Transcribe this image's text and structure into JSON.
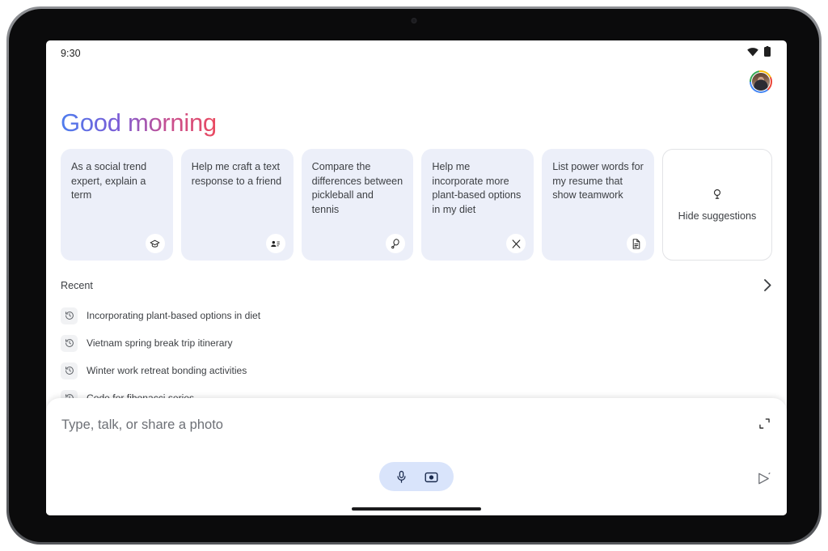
{
  "status_bar": {
    "time": "9:30",
    "icons": [
      "wifi-icon",
      "battery-icon"
    ]
  },
  "account": {
    "avatar_name": "avatar"
  },
  "greeting": {
    "text": "Good morning",
    "gradient_from": "#4285f4",
    "gradient_to": "#ea4a5f"
  },
  "suggestions": {
    "cards": [
      {
        "text": "As a social trend expert, explain a term",
        "icon": "graduation-cap-icon"
      },
      {
        "text": "Help me craft a text response to a friend",
        "icon": "contacts-icon"
      },
      {
        "text": "Compare the differences between pickleball and tennis",
        "icon": "sports-racquet-icon"
      },
      {
        "text": "Help me incorporate more plant-based options in my diet",
        "icon": "restaurant-icon"
      },
      {
        "text": "List power words for my resume that show teamwork",
        "icon": "document-icon"
      }
    ],
    "hide": {
      "label": "Hide suggestions",
      "icon": "lightbulb-icon"
    },
    "card_color": "#eceff9"
  },
  "recent": {
    "title": "Recent",
    "chevron": "chevron-right-icon",
    "items": [
      {
        "label": "Incorporating plant-based options in diet",
        "icon": "history-icon"
      },
      {
        "label": "Vietnam spring break trip itinerary",
        "icon": "history-icon"
      },
      {
        "label": "Winter work retreat bonding activities",
        "icon": "history-icon"
      },
      {
        "label": "Code for fibonacci series",
        "icon": "history-icon"
      }
    ]
  },
  "composer": {
    "placeholder": "Type, talk, or share a photo",
    "value": "",
    "expand_icon": "expand-icon",
    "mic_icon": "microphone-icon",
    "camera_icon": "camera-icon",
    "send_icon": "send-icon",
    "pill_color": "#d9e4fb"
  }
}
